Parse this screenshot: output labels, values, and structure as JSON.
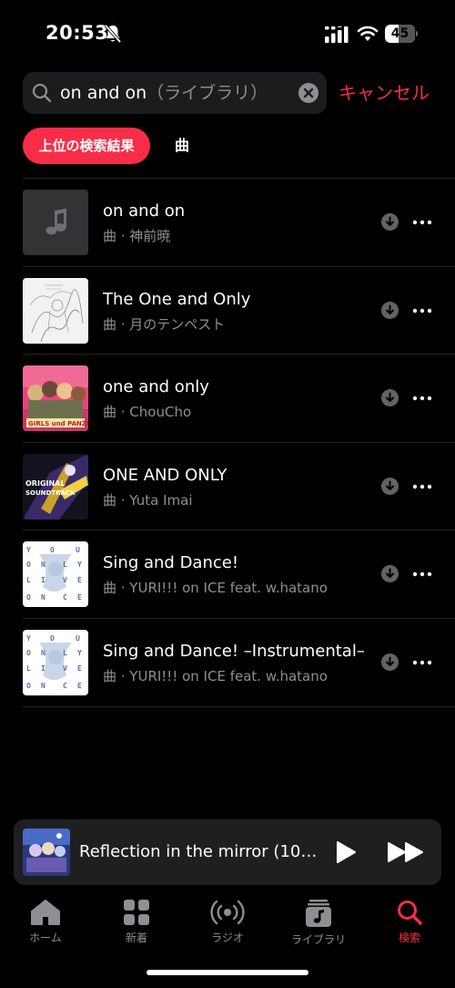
{
  "status_bar": {
    "time": "20:53",
    "battery": "45",
    "battery_level": 0.45,
    "icons": [
      "bell-slash-icon",
      "cellular-signal-icon",
      "wifi-icon",
      "battery-icon"
    ]
  },
  "search": {
    "query": "on and on",
    "placeholder": "（ライブラリ）",
    "cancel_label": "キャンセル",
    "icons": [
      "magnifying-glass-icon",
      "clear-icon"
    ]
  },
  "filters": [
    {
      "label": "上位の検索結果",
      "active": true
    },
    {
      "label": "曲",
      "active": false
    }
  ],
  "songs": [
    {
      "title": "on and on",
      "subtitle": "曲 · 神前暁",
      "artwork": "placeholder"
    },
    {
      "title": "The One and Only",
      "subtitle": "曲 · 月のテンペスト",
      "artwork": "sketch"
    },
    {
      "title": "one and only",
      "subtitle": "曲 · ChouCho",
      "artwork": "anime"
    },
    {
      "title": "ONE AND ONLY",
      "subtitle": "曲 · Yuta Imai",
      "artwork": "soundtrack"
    },
    {
      "title": "Sing and Dance!",
      "subtitle": "曲 · YURI!!! on ICE feat. w.hatano",
      "artwork": "yoi"
    },
    {
      "title": "Sing and Dance! –Instrumental–",
      "subtitle": "曲 · YURI!!! on ICE feat. w.hatano",
      "artwork": "yoi"
    }
  ],
  "now_playing": {
    "title": "Reflection in the mirror (10…",
    "icons": [
      "play-icon",
      "fast-forward-icon"
    ]
  },
  "tabs": [
    {
      "label": "ホーム",
      "icon": "home-icon",
      "active": false
    },
    {
      "label": "新着",
      "icon": "grid-icon",
      "active": false
    },
    {
      "label": "ラジオ",
      "icon": "radio-icon",
      "active": false
    },
    {
      "label": "ライブラリ",
      "icon": "library-icon",
      "active": false
    },
    {
      "label": "検索",
      "icon": "search-icon",
      "active": true
    }
  ],
  "colors": {
    "accent": "#fa2d48",
    "background": "#000000",
    "secondary_text": "#8e8e93"
  }
}
